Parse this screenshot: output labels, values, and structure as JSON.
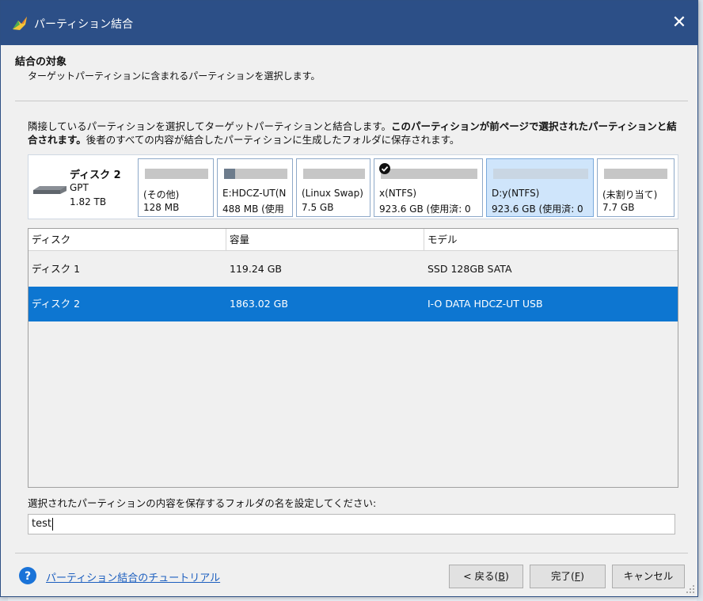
{
  "window": {
    "title": "パーティション結合",
    "close_glyph": "✕"
  },
  "header": {
    "title": "結合の対象",
    "subtitle": "ターゲットパーティションに含まれるパーティションを選択します。"
  },
  "description": {
    "part1": "隣接しているパーティションを選択してターゲットパーティションと結合します。",
    "bold": "このパーティションが前ページで選択されたパーティションと結合されます。",
    "part2": "後者のすべての内容が結合したパーティションに生成したフォルダに保存されます。"
  },
  "disk_map": {
    "disk": {
      "name": "ディスク 2",
      "type": "GPT",
      "size": "1.82 TB"
    },
    "partitions": [
      {
        "label": "(その他)",
        "detail": "128 MB",
        "used_fraction": 0.0,
        "checked": false,
        "selected": false
      },
      {
        "label": "E:HDCZ-UT(N",
        "detail": "488 MB (使用",
        "used_fraction": 0.18,
        "checked": false,
        "selected": false
      },
      {
        "label": "(Linux Swap)",
        "detail": "7.5 GB",
        "used_fraction": 0.0,
        "checked": false,
        "selected": false
      },
      {
        "label": "x(NTFS)",
        "detail": "923.6 GB (使用済: 0",
        "used_fraction": 0.0,
        "checked": true,
        "selected": false
      },
      {
        "label": "D:y(NTFS)",
        "detail": "923.6 GB (使用済: 0",
        "used_fraction": 0.0,
        "checked": false,
        "selected": true
      },
      {
        "label": "(未割り当て)",
        "detail": "7.7 GB",
        "used_fraction": 0.0,
        "checked": false,
        "selected": false
      }
    ]
  },
  "table": {
    "columns": [
      "ディスク",
      "容量",
      "モデル"
    ],
    "rows": [
      {
        "disk": "ディスク 1",
        "capacity": "119.24 GB",
        "model": "SSD 128GB SATA",
        "selected": false
      },
      {
        "disk": "ディスク 2",
        "capacity": "1863.02 GB",
        "model": "I-O DATA HDCZ-UT USB",
        "selected": true
      }
    ]
  },
  "folder": {
    "label": "選択されたパーティションの内容を保存するフォルダの名を設定してください:",
    "value": "test"
  },
  "footer": {
    "tutorial_link": "パーティション結合のチュートリアル",
    "back": {
      "text": "< 戻る(",
      "key": "B",
      "end": ")"
    },
    "finish": {
      "text": "完了(",
      "key": "F",
      "end": ")"
    },
    "cancel": "キャンセル"
  },
  "colors": {
    "titlebar": "#2c4f87",
    "selection": "#0d76d1",
    "selected_partition": "#cfe5fb",
    "link": "#1d5fbf"
  }
}
